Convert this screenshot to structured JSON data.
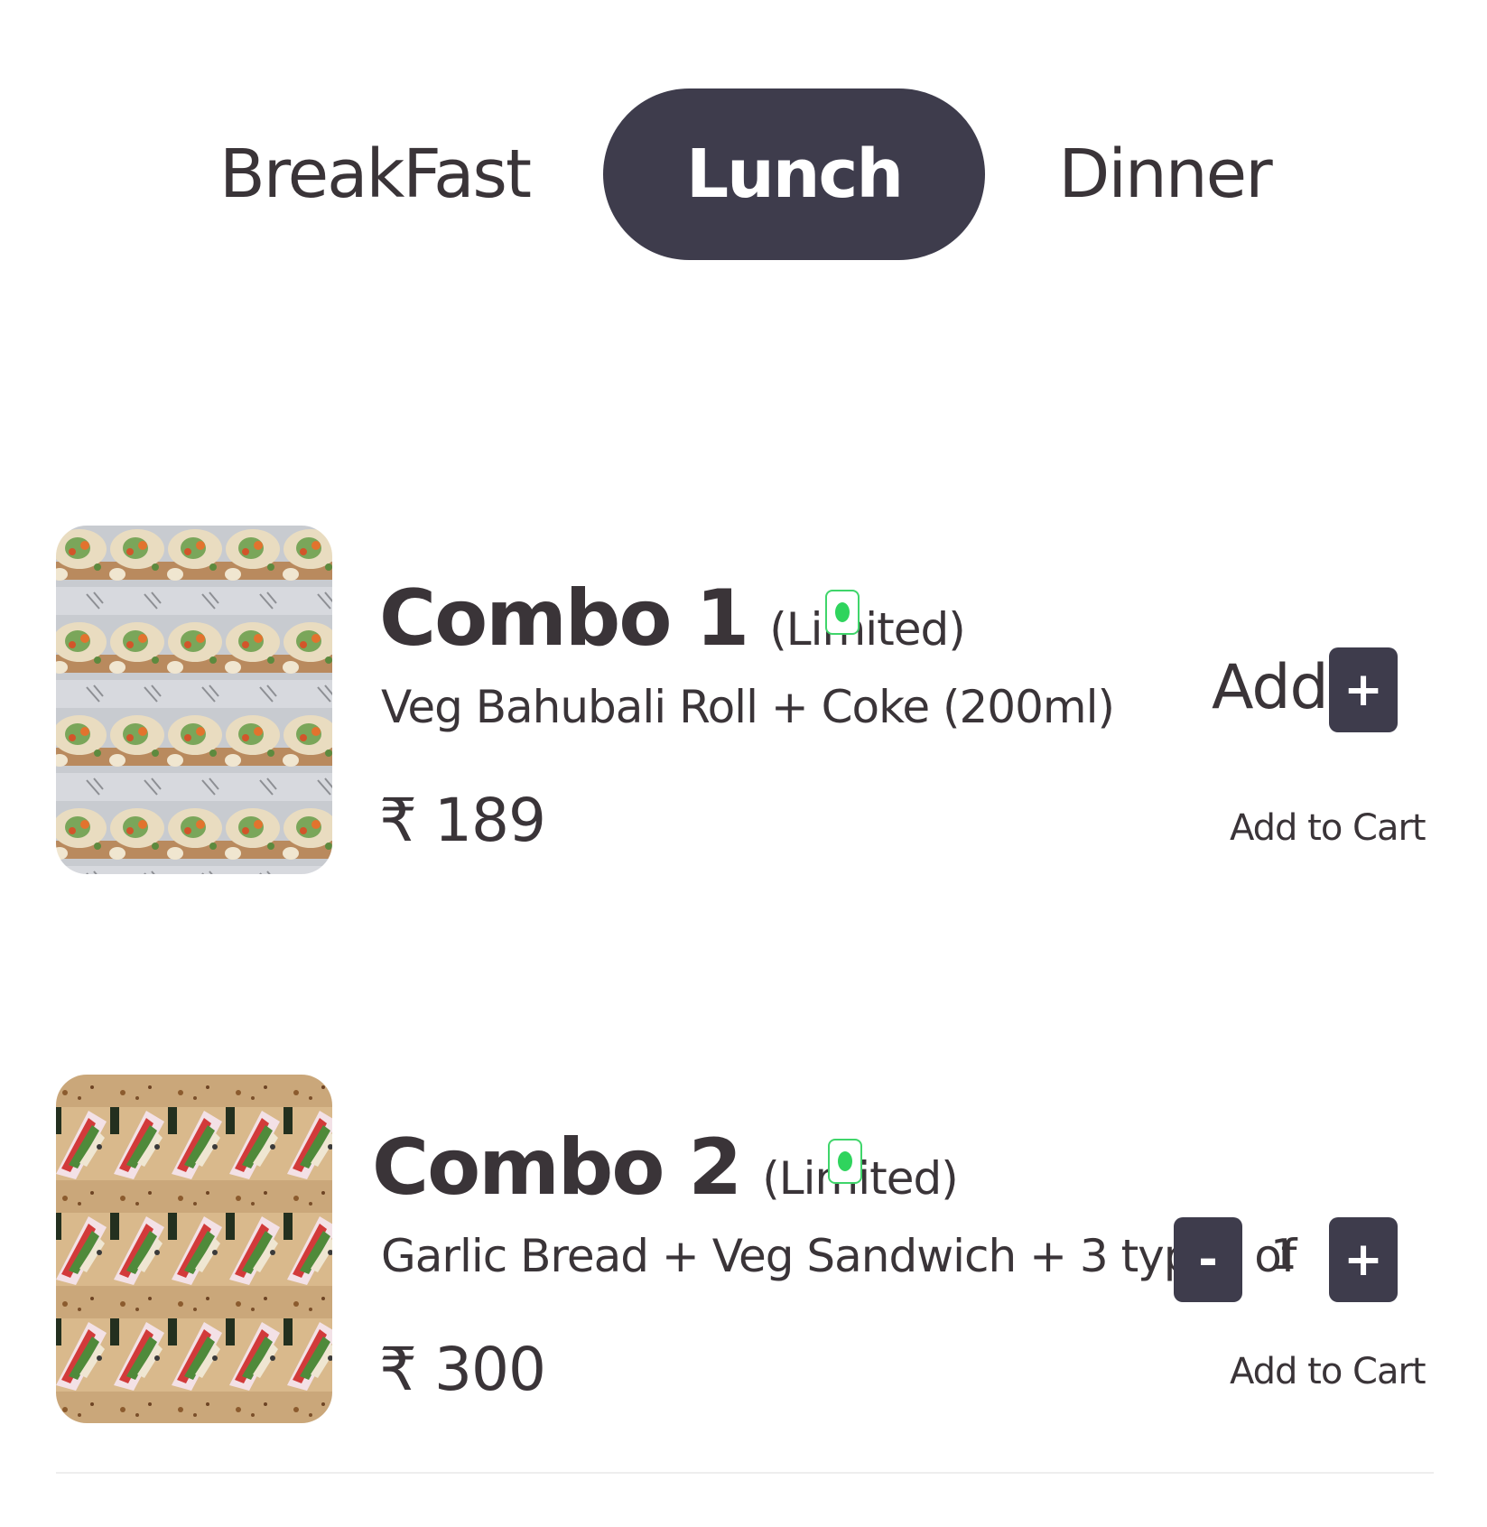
{
  "tabs": [
    {
      "label": "BreakFast",
      "active": false
    },
    {
      "label": "Lunch",
      "active": true
    },
    {
      "label": "Dinner",
      "active": false
    }
  ],
  "items": [
    {
      "name": "Combo 1",
      "tag": "(Limited)",
      "description": "Veg Bahubali Roll + Coke (200ml)",
      "price": "₹ 189",
      "add_label": "Add",
      "plus_label": "+",
      "cart_label": "Add to Cart",
      "veg": true
    },
    {
      "name": "Combo 2",
      "tag": "(Limited)",
      "description": "Garlic Bread + Veg Sandwich + 3 types of",
      "price": "₹ 300",
      "minus_label": "-",
      "quantity": "1",
      "plus_label": "+",
      "cart_label": "Add to Cart",
      "veg": true
    }
  ],
  "colors": {
    "accent": "#3e3c4c",
    "text": "#3a3438",
    "veg_green": "#2fd45d"
  }
}
